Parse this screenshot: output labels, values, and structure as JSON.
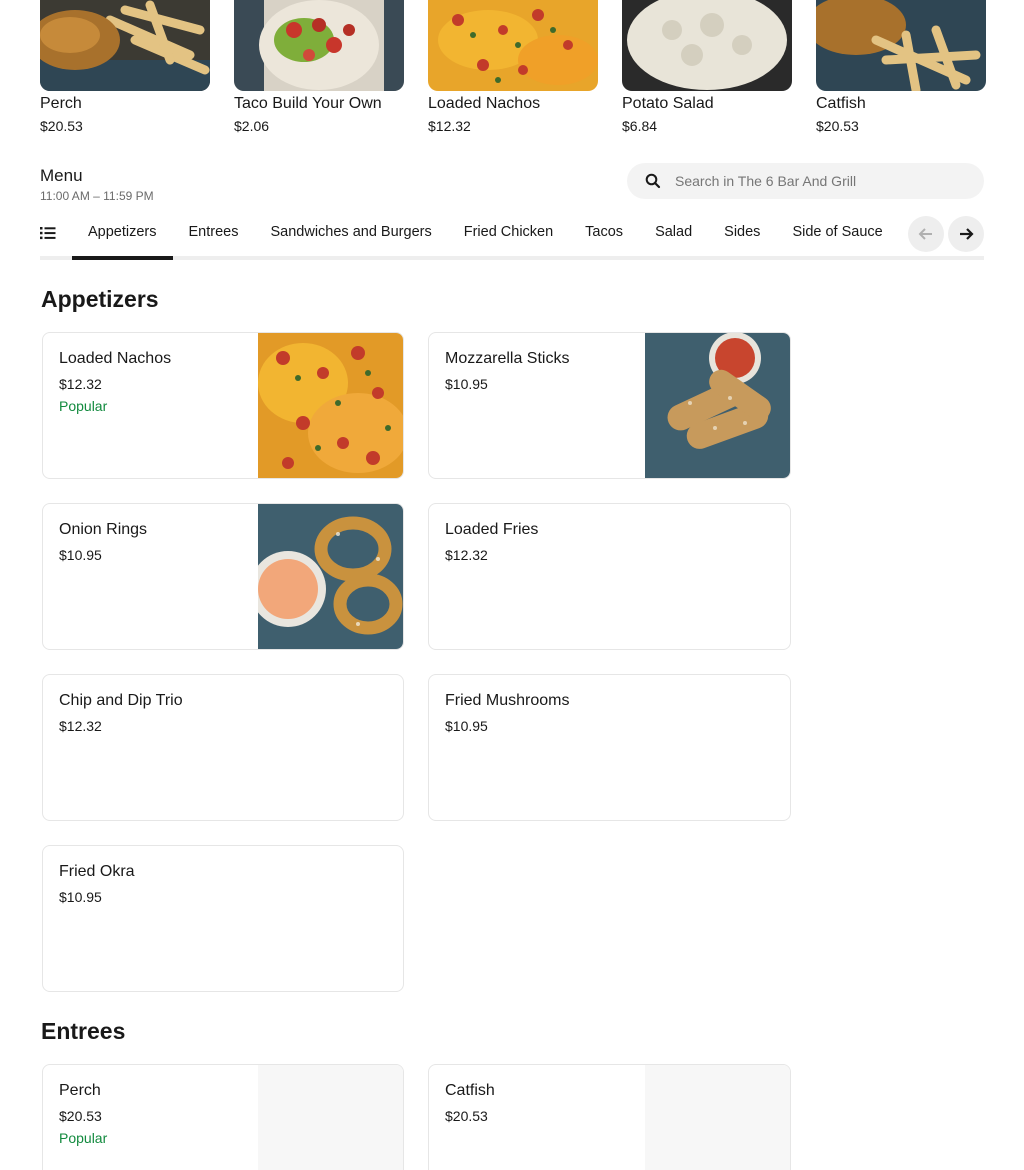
{
  "featured": [
    {
      "name": "Perch",
      "price": "$20.53"
    },
    {
      "name": "Taco Build Your Own",
      "price": "$2.06"
    },
    {
      "name": "Loaded Nachos",
      "price": "$12.32"
    },
    {
      "name": "Potato Salad",
      "price": "$6.84"
    },
    {
      "name": "Catfish",
      "price": "$20.53"
    }
  ],
  "menu": {
    "title": "Menu",
    "hours": "11:00 AM – 11:59 PM"
  },
  "search": {
    "placeholder": "Search in The 6 Bar And Grill"
  },
  "tabs": [
    "Appetizers",
    "Entrees",
    "Sandwiches and Burgers",
    "Fried Chicken",
    "Tacos",
    "Salad",
    "Sides",
    "Side of Sauce"
  ],
  "active_tab": "Appetizers",
  "sections": {
    "appetizers": {
      "title": "Appetizers",
      "items": [
        {
          "name": "Loaded Nachos",
          "price": "$12.32",
          "badge": "Popular"
        },
        {
          "name": "Mozzarella Sticks",
          "price": "$10.95"
        },
        {
          "name": "Onion Rings",
          "price": "$10.95"
        },
        {
          "name": "Loaded Fries",
          "price": "$12.32"
        },
        {
          "name": "Chip and Dip Trio",
          "price": "$12.32"
        },
        {
          "name": "Fried Mushrooms",
          "price": "$10.95"
        },
        {
          "name": "Fried Okra",
          "price": "$10.95"
        }
      ]
    },
    "entrees": {
      "title": "Entrees",
      "items": [
        {
          "name": "Perch",
          "price": "$20.53",
          "badge": "Popular"
        },
        {
          "name": "Catfish",
          "price": "$20.53"
        }
      ]
    }
  },
  "colors": {
    "popular": "#128a3e",
    "text": "#191919",
    "muted": "#6b6b6b",
    "search_bg": "#f3f3f3"
  }
}
